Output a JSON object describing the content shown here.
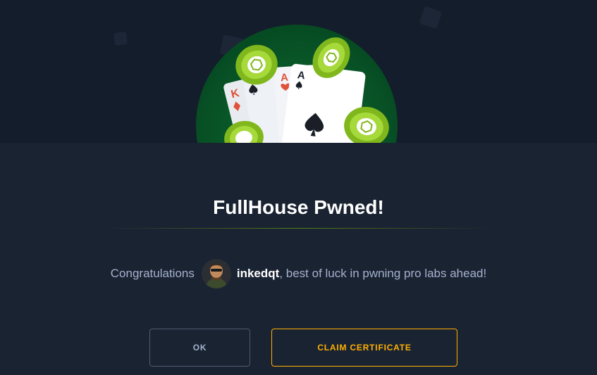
{
  "modal": {
    "title": "FullHouse Pwned!",
    "message": {
      "prefix": "Congratulations",
      "username": "inkedqt",
      "suffix": ", best of luck in pwning pro labs ahead!"
    },
    "buttons": {
      "ok_label": "OK",
      "claim_label": "CLAIM CERTIFICATE"
    }
  },
  "hero": {
    "card_ranks": [
      "K",
      "A",
      "A"
    ],
    "card_suits": [
      "diamond-icon",
      "spade-icon",
      "heart-icon",
      "spade-icon"
    ],
    "chip_icon": "cube-icon"
  },
  "colors": {
    "background": "#1a2332",
    "hero_background": "#141d2b",
    "accent_green": "#9fef00",
    "circle_green": "#0b5a2a",
    "claim_orange": "#ffaf00",
    "ok_border": "#4b5a70",
    "text_muted": "#a4b1cd"
  }
}
